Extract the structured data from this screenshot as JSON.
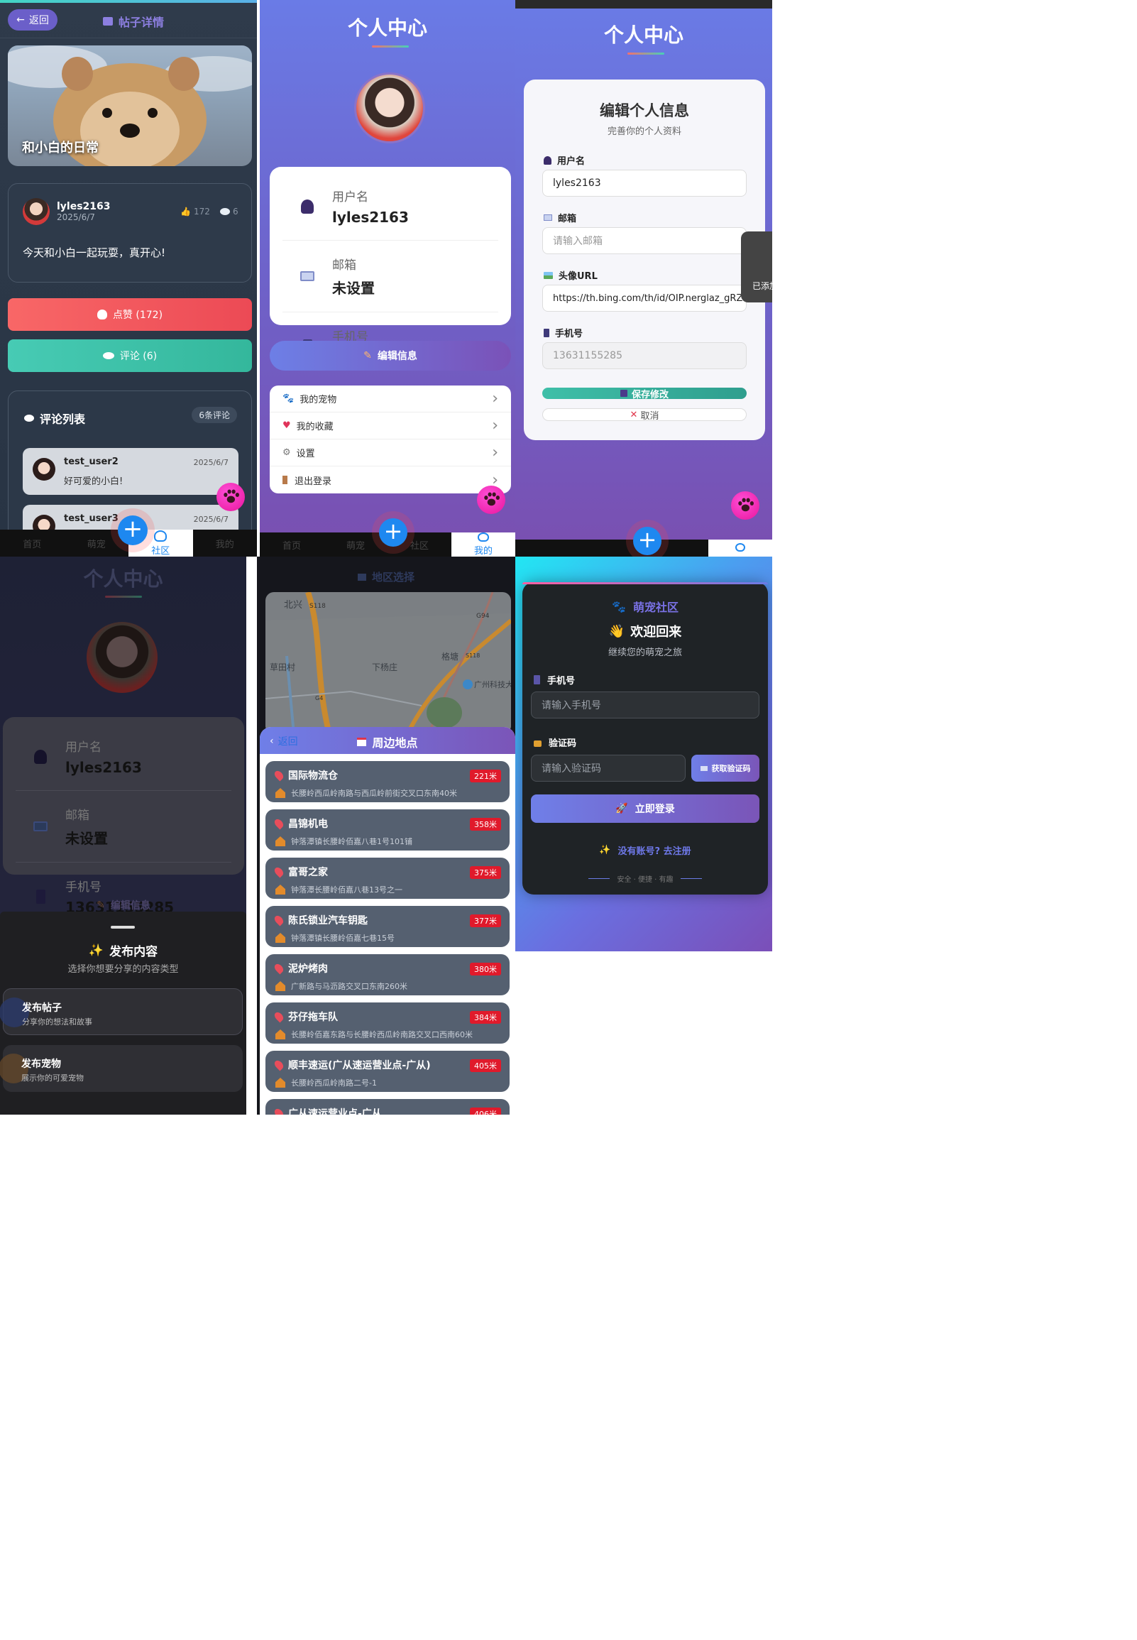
{
  "post": {
    "back_label": "返回",
    "page_title": "帖子详情",
    "hero_title": "和小白的日常",
    "author": "lyles2163",
    "date": "2025/6/7",
    "like_count": "172",
    "comment_count": "6",
    "content": "今天和小白一起玩耍，真开心!",
    "like_button": "点赞 (172)",
    "comment_button": "评论 (6)",
    "comments_title": "评论列表",
    "comments_badge": "6条评论",
    "comments": [
      {
        "user": "test_user2",
        "date": "2025/6/7",
        "text": "好可爱的小白!"
      },
      {
        "user": "test_user3",
        "date": "2025/6/7",
        "text": ""
      }
    ],
    "tabs": [
      "首页",
      "萌宠",
      "社区",
      "我的"
    ]
  },
  "profile": {
    "title": "个人中心",
    "username_label": "用户名",
    "username": "lyles2163",
    "email_label": "邮箱",
    "email": "未设置",
    "phone_label": "手机号",
    "phone": "13631155285",
    "edit_button": "编辑信息",
    "menu": [
      "我的宠物",
      "我的收藏",
      "设置",
      "退出登录"
    ],
    "tabs": [
      "首页",
      "萌宠",
      "社区",
      "我的"
    ]
  },
  "edit": {
    "title": "个人中心",
    "card_title": "编辑个人信息",
    "card_subtitle": "完善你的个人资料",
    "username_label": "用户名",
    "username_value": "lyles2163",
    "email_label": "邮箱",
    "email_placeholder": "请输入邮箱",
    "avatar_label": "头像URL",
    "avatar_value": "https://th.bing.com/th/id/OIP.nerglaz_gRZR",
    "phone_label": "手机号",
    "phone_value": "13631155285",
    "save_button": "保存修改",
    "cancel_button": "取消",
    "toast": "已添加"
  },
  "publish": {
    "title": "个人中心",
    "username_label": "用户名",
    "username": "lyles2163",
    "email_label": "邮箱",
    "email": "未设置",
    "phone_label": "手机号",
    "phone": "13631155285",
    "edit_button": "编辑信息",
    "sheet_title": "发布内容",
    "sheet_subtitle": "选择你想要分享的内容类型",
    "options": [
      {
        "title": "发布帖子",
        "desc": "分享你的想法和故事"
      },
      {
        "title": "发布宠物",
        "desc": "展示你的可爱宠物"
      }
    ]
  },
  "map": {
    "page_title": "地区选择",
    "back_label": "返回",
    "panel_title": "周边地点",
    "map_labels": [
      "北兴",
      "S118",
      "G94",
      "格塘",
      "草田村",
      "下杨庄",
      "广州科技大学(广州",
      "S118",
      "G4"
    ],
    "places": [
      {
        "name": "国际物流仓",
        "distance": "221米",
        "address": "长腰岭西瓜岭南路与西瓜岭前街交叉口东南40米"
      },
      {
        "name": "昌锦机电",
        "distance": "358米",
        "address": "钟落潭镇长腰岭佰嘉八巷1号101铺"
      },
      {
        "name": "富哥之家",
        "distance": "375米",
        "address": "钟落潭长腰岭佰嘉八巷13号之一"
      },
      {
        "name": "陈氏锁业汽车钥匙",
        "distance": "377米",
        "address": "钟落潭镇长腰岭佰嘉七巷15号"
      },
      {
        "name": "泥炉烤肉",
        "distance": "380米",
        "address": "广新路与马沥路交叉口东南260米"
      },
      {
        "name": "芬仔拖车队",
        "distance": "384米",
        "address": "长腰岭佰嘉东路与长腰岭西瓜岭南路交叉口西南60米"
      },
      {
        "name": "顺丰速运(广从速运营业点-广从)",
        "distance": "405米",
        "address": "长腰岭西瓜岭南路二号-1"
      },
      {
        "name": "广从速运营业点-广从",
        "distance": "406米",
        "address": ""
      }
    ]
  },
  "login": {
    "brand": "萌宠社区",
    "welcome": "欢迎回来",
    "subtitle": "继续您的萌宠之旅",
    "phone_label": "手机号",
    "phone_placeholder": "请输入手机号",
    "code_label": "验证码",
    "code_placeholder": "请输入验证码",
    "get_code_button": "获取验证码",
    "login_button": "立即登录",
    "register_prompt": "没有账号? 去注册",
    "footer": "安全 · 便捷 · 有趣"
  },
  "colors": {
    "purple": "#6c5fd7",
    "like_red": "#f05a5a",
    "teal": "#3cc6a6",
    "fab_blue": "#1e88f0",
    "dist_red": "#e01a2b"
  }
}
